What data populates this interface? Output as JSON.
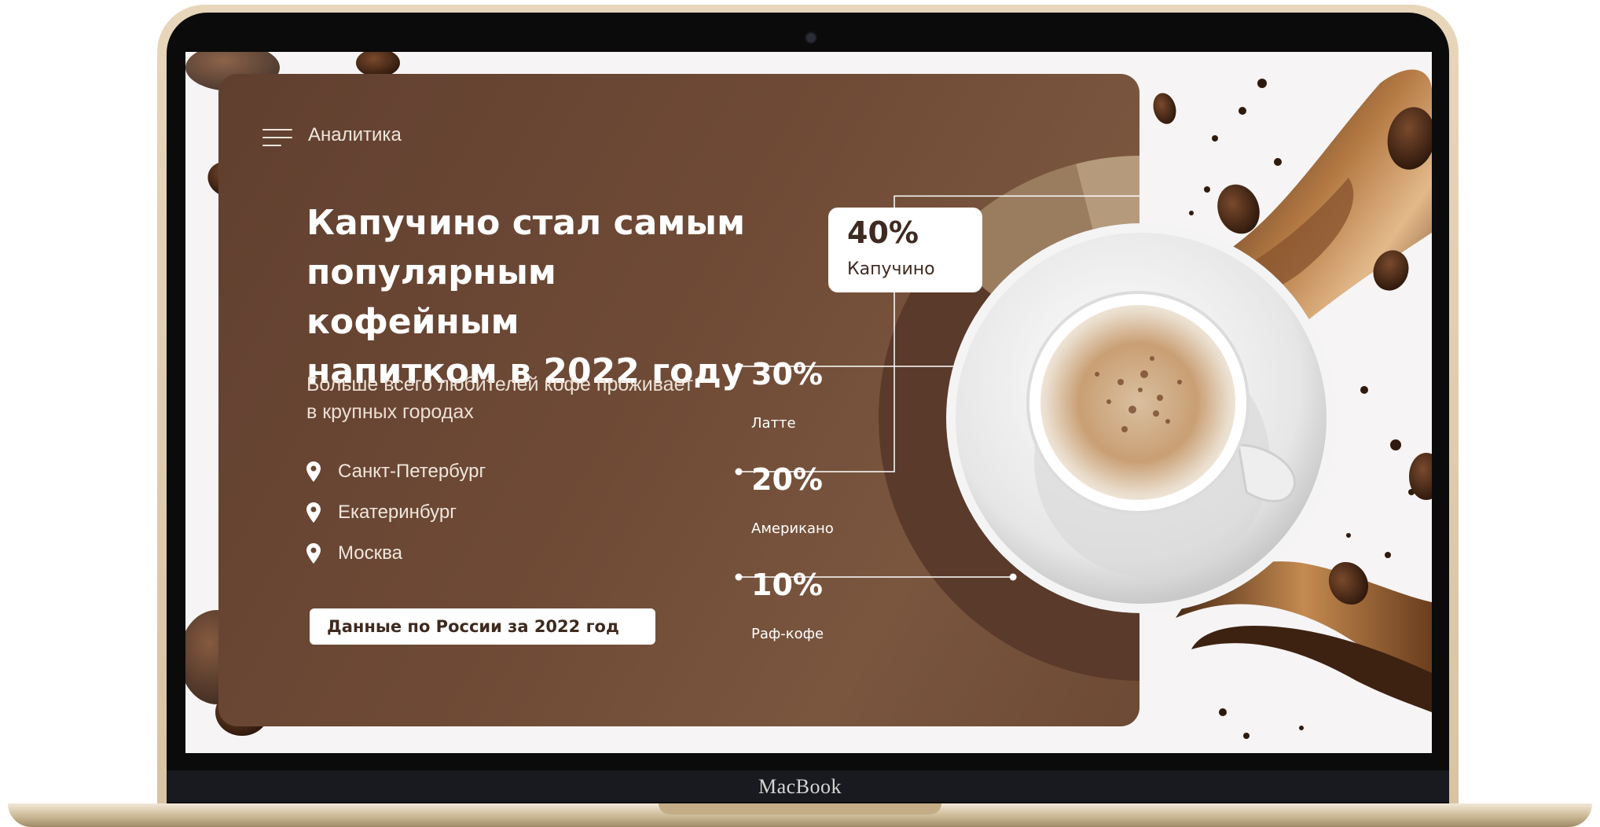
{
  "device": {
    "brand": "MacBook"
  },
  "header": {
    "menu_label": "Аналитика"
  },
  "headline": {
    "line1": "Капучино стал самым",
    "line2": "популярным кофейным",
    "line3": "напитком в 2022 году"
  },
  "subtitle": {
    "line1": "Больше всего любителей кофе проживает",
    "line2": "в крупных городах"
  },
  "cities": [
    "Санкт-Петербург",
    "Екатеринбург",
    "Москва"
  ],
  "button": {
    "label": "Данные по России за 2022 год"
  },
  "icons": {
    "menu": "menu-icon",
    "location": "location-pin-icon"
  },
  "colors": {
    "card": "#6b4735",
    "slice_cappuccino": "#5a3a2b",
    "slice_latte": "#ddd2c6",
    "slice_americano": "#b59a7c",
    "slice_raf": "#9a7c5e"
  },
  "chart_data": {
    "type": "pie",
    "categories": [
      "Капучино",
      "Латте",
      "Американо",
      "Раф-кофе"
    ],
    "values": [
      40,
      30,
      20,
      10
    ],
    "labels": [
      "40%",
      "30%",
      "20%",
      "10%"
    ]
  }
}
